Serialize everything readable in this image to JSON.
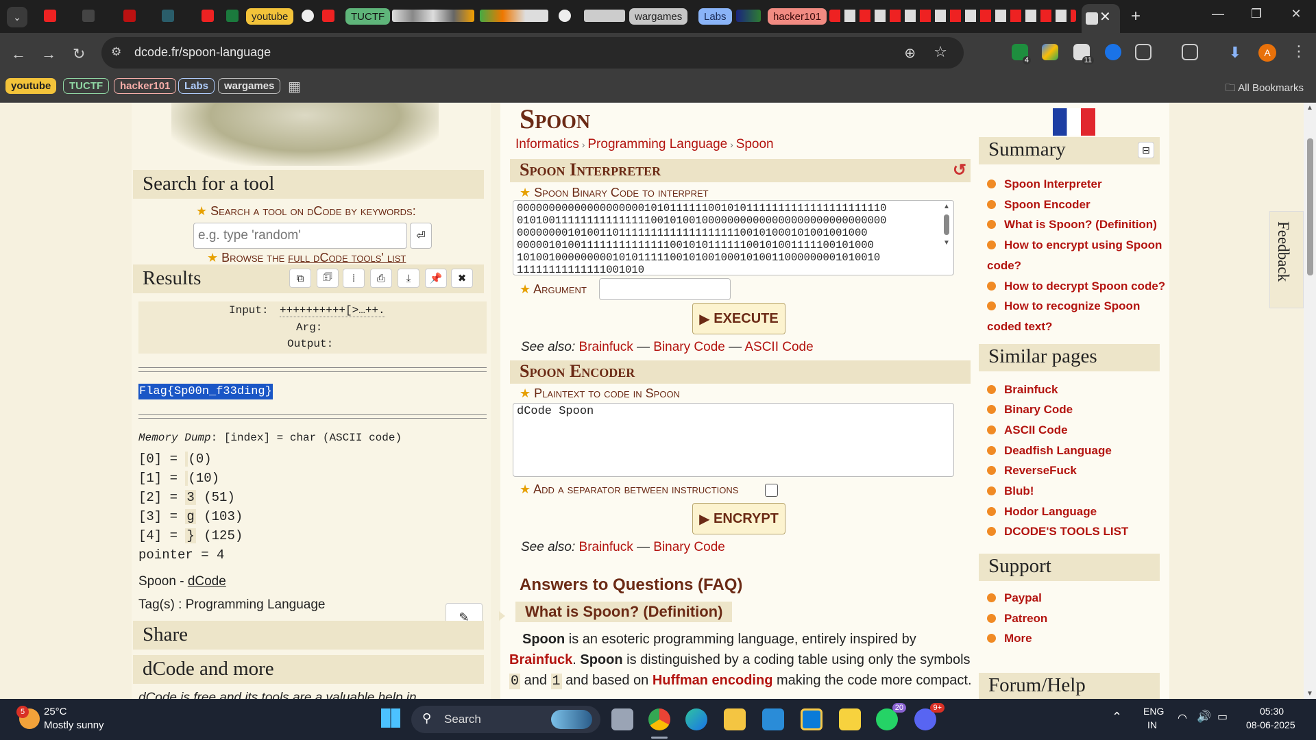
{
  "browser": {
    "tabs_chips": [
      "youtube",
      "TUCTF",
      "wargames",
      "Labs",
      "hacker101"
    ],
    "url": "dcode.fr/spoon-language",
    "extension_badges": [
      "4",
      "11"
    ],
    "avatar_initial": "A",
    "bookmarks": [
      "youtube",
      "TUCTF",
      "hacker101",
      "Labs",
      "wargames"
    ],
    "all_bookmarks": "All Bookmarks"
  },
  "left": {
    "search_heading": "Search for a tool",
    "search_label": "Search a tool on dCode by keywords:",
    "search_placeholder": "e.g. type 'random'",
    "browse_prefix": "Browse the ",
    "browse_link": "full dCode tools' list",
    "results_heading": "Results",
    "result_labels": {
      "input": "Input:",
      "arg": "Arg:",
      "output": "Output:"
    },
    "input_value": "++++++++++[>…++.",
    "flag": "Flag{Sp00n_f33ding}",
    "memory_dump_label": "Memory Dump",
    "memory_dump_format": ": [index] = char (ASCII code)",
    "memory": [
      {
        "idx": "[0] =",
        "ch": "",
        "code": "(0)"
      },
      {
        "idx": "[1] =",
        "ch": "",
        "code": "(10)"
      },
      {
        "idx": "[2] =",
        "ch": "3",
        "code": "(51)"
      },
      {
        "idx": "[3] =",
        "ch": "g",
        "code": "(103)"
      },
      {
        "idx": "[4] =",
        "ch": "}",
        "code": "(125)"
      }
    ],
    "pointer": "pointer = 4",
    "credit_prefix": "Spoon - ",
    "credit_link": "dCode",
    "tags": "Tag(s) : Programming Language",
    "share_heading": "Share",
    "more_heading": "dCode and more",
    "cut_text": "dCode is free and its tools are a valuable help in"
  },
  "main": {
    "title": "Spoon",
    "breadcrumb": [
      "Informatics",
      "Programming Language",
      "Spoon"
    ],
    "interpreter_heading": "Spoon Interpreter",
    "interpreter_label": "Spoon Binary Code to interpret",
    "binary_code": "0000000000000000000010101111110010101111111111111111111110\n0101001111111111111110010100100000000000000000000000000000\n0000000010100110111111111111111111100101000101001001000\n00000101001111111111111100101011111100101001111100101000\n101001000000000101011111001010010001010011000000001010010\n11111111111111001010",
    "argument_label": "Argument",
    "execute_label": "EXECUTE",
    "see_also_label": "See also:",
    "see_also_interp": [
      "Brainfuck",
      "Binary Code",
      "ASCII Code"
    ],
    "encoder_heading": "Spoon Encoder",
    "plaintext_label": "Plaintext to code in Spoon",
    "plaintext_value": "dCode Spoon",
    "separator_label": "Add a separator between instructions",
    "encrypt_label": "ENCRYPT",
    "see_also_enc": [
      "Brainfuck",
      "Binary Code"
    ],
    "faq_heading": "Answers to Questions (FAQ)",
    "faq_q1": "What is Spoon? (Definition)",
    "faq_p1_a": "Spoon",
    "faq_p1_b": " is an esoteric programming language, entirely inspired by",
    "faq_p2_a": "Brainfuck",
    "faq_p2_b": ". ",
    "faq_p2_c": "Spoon",
    "faq_p2_d": " is distinguished by a coding table using only the symbols",
    "faq_p3_a": "0",
    "faq_p3_b": " and ",
    "faq_p3_c": "1",
    "faq_p3_d": " and based on ",
    "faq_p3_e": "Huffman encoding",
    "faq_p3_f": " making the code more compact."
  },
  "right": {
    "summary_heading": "Summary",
    "summary_links": [
      "Spoon Interpreter",
      "Spoon Encoder",
      "What is Spoon? (Definition)",
      "How to encrypt using Spoon code?",
      "How to decrypt Spoon code?",
      "How to recognize Spoon coded text?"
    ],
    "similar_heading": "Similar pages",
    "similar_links": [
      "Brainfuck",
      "Binary Code",
      "ASCII Code",
      "Deadfish Language",
      "ReverseFuck",
      "Blub!",
      "Hodor Language",
      "DCODE'S TOOLS LIST"
    ],
    "support_heading": "Support",
    "support_links": [
      "Paypal",
      "Patreon",
      "More"
    ],
    "forum_heading": "Forum/Help",
    "feedback": "Feedback"
  },
  "taskbar": {
    "weather_badge": "5",
    "temp": "25°C",
    "weather": "Mostly sunny",
    "search": "Search",
    "whatsapp_badge": "20",
    "discord_badge": "9+",
    "lang1": "ENG",
    "lang2": "IN",
    "time": "05:30",
    "date": "08-06-2025"
  }
}
